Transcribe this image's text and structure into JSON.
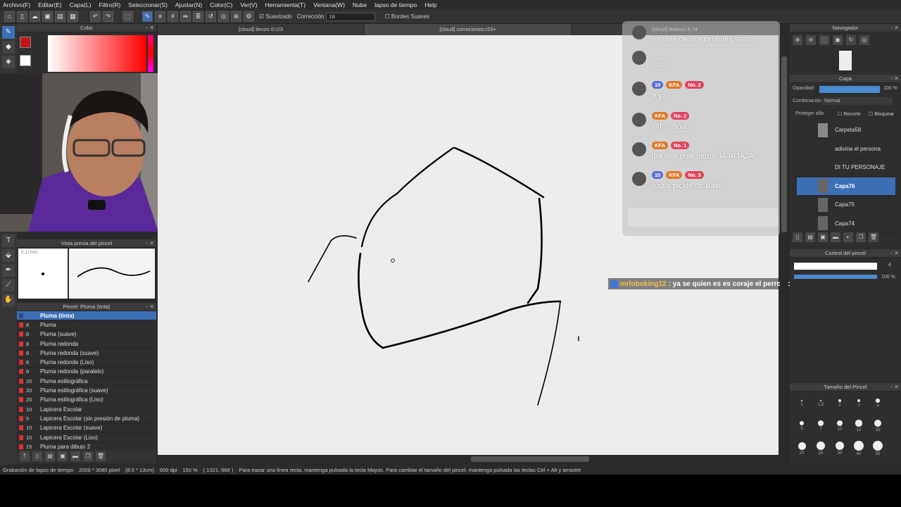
{
  "menu": [
    "Archivo(F)",
    "Editar(E)",
    "Capa(L)",
    "Filtro(R)",
    "Seleccionar(S)",
    "Ajustar(N)",
    "Color(C)",
    "Ver(V)",
    "Herramienta(T)",
    "Ventana(W)",
    "Nube",
    "lapso de tiempo",
    "Help"
  ],
  "toolbar": {
    "suavizado": "Suavizado",
    "correccion": "Corrección",
    "correccion_value": "18",
    "bordes": "Bordes Suaves"
  },
  "tabs": [
    "[cloud] lienzo 6:r23",
    "[cloud] correciones:r23+",
    "[cloud] lluenzo 5:74"
  ],
  "panels": {
    "color": "Color",
    "brush_preview": "Vista previa del pincel",
    "brush_size_label": "0.17mm",
    "brush_list": "Pincel: Pluma (tinta)",
    "navigator": "Navegador",
    "layer": "Capa",
    "opacity_label": "Opacidad",
    "opacity_value": "100 %",
    "blend_label": "Combinación",
    "blend_value": "Normal",
    "protect": "Proteger alfa",
    "clip": "Recorte",
    "lock": "Bloquear",
    "brush_control": "Control del pincel",
    "brush_control_size": "4",
    "brush_control_opacity": "100 %",
    "brush_sizes": "Tamaño del Pincel"
  },
  "brushes": [
    {
      "size": "",
      "name": "Pluma (tinta)",
      "color": "#3d6fb5"
    },
    {
      "size": "8",
      "name": "Pluma",
      "color": "#e03030"
    },
    {
      "size": "8",
      "name": "Pluma (suave)",
      "color": "#e03030"
    },
    {
      "size": "8",
      "name": "Pluma redonda",
      "color": "#e03030"
    },
    {
      "size": "8",
      "name": "Pluma redonda (suave)",
      "color": "#e03030"
    },
    {
      "size": "8",
      "name": "Pluma redonda (Liso)",
      "color": "#e03030"
    },
    {
      "size": "8",
      "name": "Pluma redonda (paralelo)",
      "color": "#e03030"
    },
    {
      "size": "20",
      "name": "Pluma estilográfica",
      "color": "#e03030"
    },
    {
      "size": "20",
      "name": "Pluma estilográfica (suave)",
      "color": "#e03030"
    },
    {
      "size": "20",
      "name": "Pluma estilográfica (Liso)",
      "color": "#e03030"
    },
    {
      "size": "10",
      "name": "Lapicera Escolar",
      "color": "#e03030"
    },
    {
      "size": "5",
      "name": "Lapicera Escolar (sin presión de pluma)",
      "color": "#e03030"
    },
    {
      "size": "10",
      "name": "Lapicera Escolar (suave)",
      "color": "#e03030"
    },
    {
      "size": "10",
      "name": "Lapicera Escolar (Liso)",
      "color": "#e03030"
    },
    {
      "size": "15",
      "name": "Pluma para dibujo 2",
      "color": "#e03030"
    }
  ],
  "layers": [
    {
      "name": "Carpeta58",
      "type": "folder"
    },
    {
      "name": "adivina el persona",
      "type": "text"
    },
    {
      "name": "DI TU PERSONAJE",
      "type": "text"
    },
    {
      "name": "Capa76",
      "type": "raster",
      "selected": true
    },
    {
      "name": "Capa75",
      "type": "raster"
    },
    {
      "name": "Capa74",
      "type": "raster"
    }
  ],
  "brush_size_grid": [
    "1",
    "1.5",
    "2",
    "3",
    "4",
    "5",
    "7",
    "10",
    "12",
    "15",
    "20",
    "25",
    "30",
    "40",
    "50"
  ],
  "chat": [
    {
      "name": "",
      "badges": [],
      "text": "es ulon de dragon ball classic"
    },
    {
      "name": "",
      "badges": [],
      "text": "hola"
    },
    {
      "name": "",
      "badges": [
        "10",
        "KFA",
        "No. 2"
      ],
      "text": "a ya"
    },
    {
      "name": "",
      "badges": [
        "KFA",
        "No. 2"
      ],
      "text": "@f_.! hola"
    },
    {
      "name": "",
      "badges": [
        "KFA",
        "No. 1"
      ],
      "text": "iba tirar pow patról JAJAJAJA"
    },
    {
      "name": "",
      "badges": [
        "10",
        "KFA",
        "No. 3"
      ],
      "text": "haz a pickle de Baki"
    }
  ],
  "notification": {
    "user": "mrloboking12",
    "text": ": ya se quien es es coraje el perro cobarde"
  },
  "status": {
    "recording": "Grabación de lapso de tiempo",
    "size": "2000 * 3080 pixel",
    "cm": "(8.5 * 13cm)",
    "dpi": "600 dpi",
    "zoom": "150 %",
    "coords": "( 1321, 669 )",
    "hint": "Para trazar una línea recta, mantenga pulsada la tecla Mayús. Para cambiar el tamaño del pincel, mantenga pulsada las teclas Ctrl + Alt y arrastre"
  },
  "colors": {
    "accent": "#3d6fb5",
    "canvas": "#ececec",
    "fg_color": "#c0181a"
  }
}
